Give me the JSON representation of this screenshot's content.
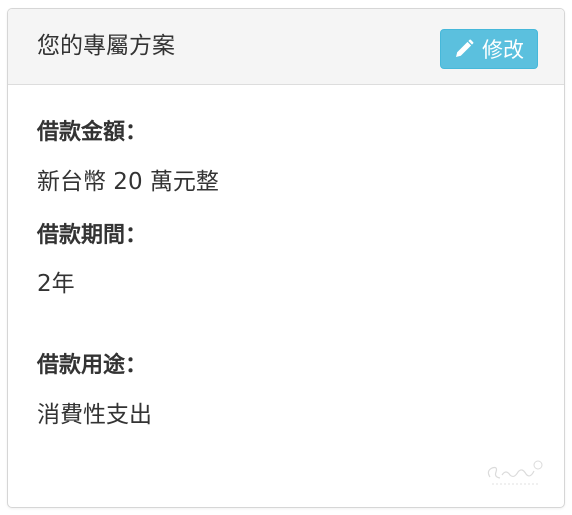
{
  "panel": {
    "title": "您的專屬方案",
    "edit_label": "修改",
    "accent_color": "#5bc0de"
  },
  "fields": [
    {
      "label": "借款金額：",
      "value": "新台幣 20 萬元整"
    },
    {
      "label": "借款期間：",
      "value": "2年"
    },
    {
      "label": "借款用途：",
      "value": "消費性支出"
    }
  ]
}
